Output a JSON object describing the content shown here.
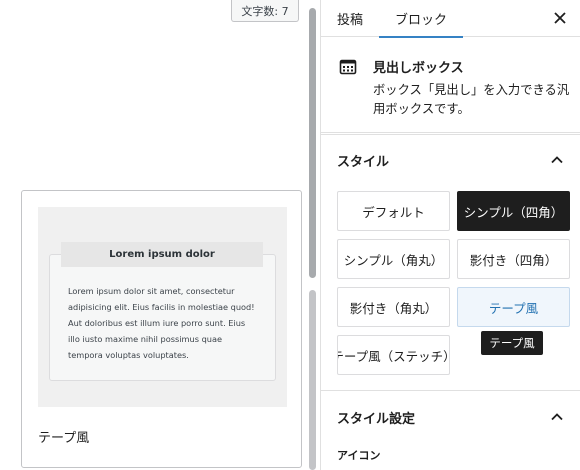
{
  "editor": {
    "char_count": "文字数: 7",
    "preview": {
      "demo_title": "Lorem ipsum dolor",
      "demo_text": "Lorem ipsum dolor sit amet, consectetur adipisicing elit. Eius facilis in molestiae quod! Aut doloribus est illum iure porro sunt. Eius illo iusto maxime nihil possimus quae tempora voluptas voluptates.",
      "label": "テープ風"
    }
  },
  "sidebar": {
    "tabs": [
      {
        "label": "投稿"
      },
      {
        "label": "ブロック"
      }
    ],
    "close_icon": "close-icon",
    "block": {
      "icon": "calendar-grid-icon",
      "title": "見出しボックス",
      "description": "ボックス「見出し」を入力できる汎用ボックスです。"
    },
    "styles_panel": {
      "title": "スタイル",
      "toggle_icon": "chevron-up-icon",
      "buttons": [
        {
          "label": "デフォルト"
        },
        {
          "label": "シンプル（四角）"
        },
        {
          "label": "シンプル（角丸）"
        },
        {
          "label": "影付き（四角）"
        },
        {
          "label": "影付き（角丸）"
        },
        {
          "label": "テープ風"
        },
        {
          "label": "テープ風（ステッチ）"
        }
      ],
      "selected": "シンプル（四角）",
      "hovered": "テープ風",
      "tooltip": "テープ風"
    },
    "style_settings_panel": {
      "title": "スタイル設定",
      "toggle_icon": "chevron-up-icon",
      "icon_label": "アイコン"
    }
  },
  "colors": {
    "accent": "#3582c4",
    "selected_bg": "#1e1e1e",
    "hover_text": "#2271b1"
  }
}
